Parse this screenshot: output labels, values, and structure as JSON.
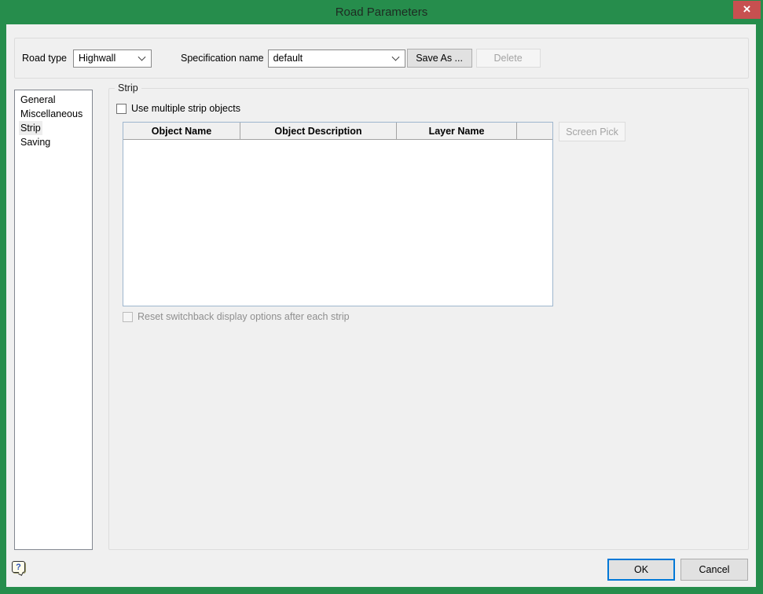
{
  "window": {
    "title": "Road Parameters",
    "close_glyph": "×"
  },
  "toolbar": {
    "road_type_label": "Road type",
    "road_type_value": "Highwall",
    "spec_name_label": "Specification name",
    "spec_name_value": "default",
    "save_as_label": "Save As ...",
    "delete_label": "Delete"
  },
  "sidebar": {
    "items": [
      {
        "label": "General",
        "selected": false
      },
      {
        "label": "Miscellaneous",
        "selected": false
      },
      {
        "label": "Strip",
        "selected": true
      },
      {
        "label": "Saving",
        "selected": false
      }
    ]
  },
  "strip_section": {
    "group_label": "Strip",
    "use_multiple_label": "Use multiple strip objects",
    "use_multiple_checked": false,
    "table": {
      "columns": [
        "Object Name",
        "Object Description",
        "Layer Name"
      ],
      "rows": []
    },
    "screen_pick_label": "Screen Pick",
    "screen_pick_enabled": false,
    "reset_label": "Reset switchback display options after each strip",
    "reset_checked": false,
    "reset_enabled": false
  },
  "footer": {
    "help_glyph": "?",
    "ok_label": "OK",
    "cancel_label": "Cancel"
  },
  "colors": {
    "title_bar_green": "#268d4c",
    "close_button_red": "#c75050",
    "client_background": "#f0f0f0",
    "table_border_blue": "#9eb6ce",
    "ok_border_blue": "#0078d7"
  }
}
